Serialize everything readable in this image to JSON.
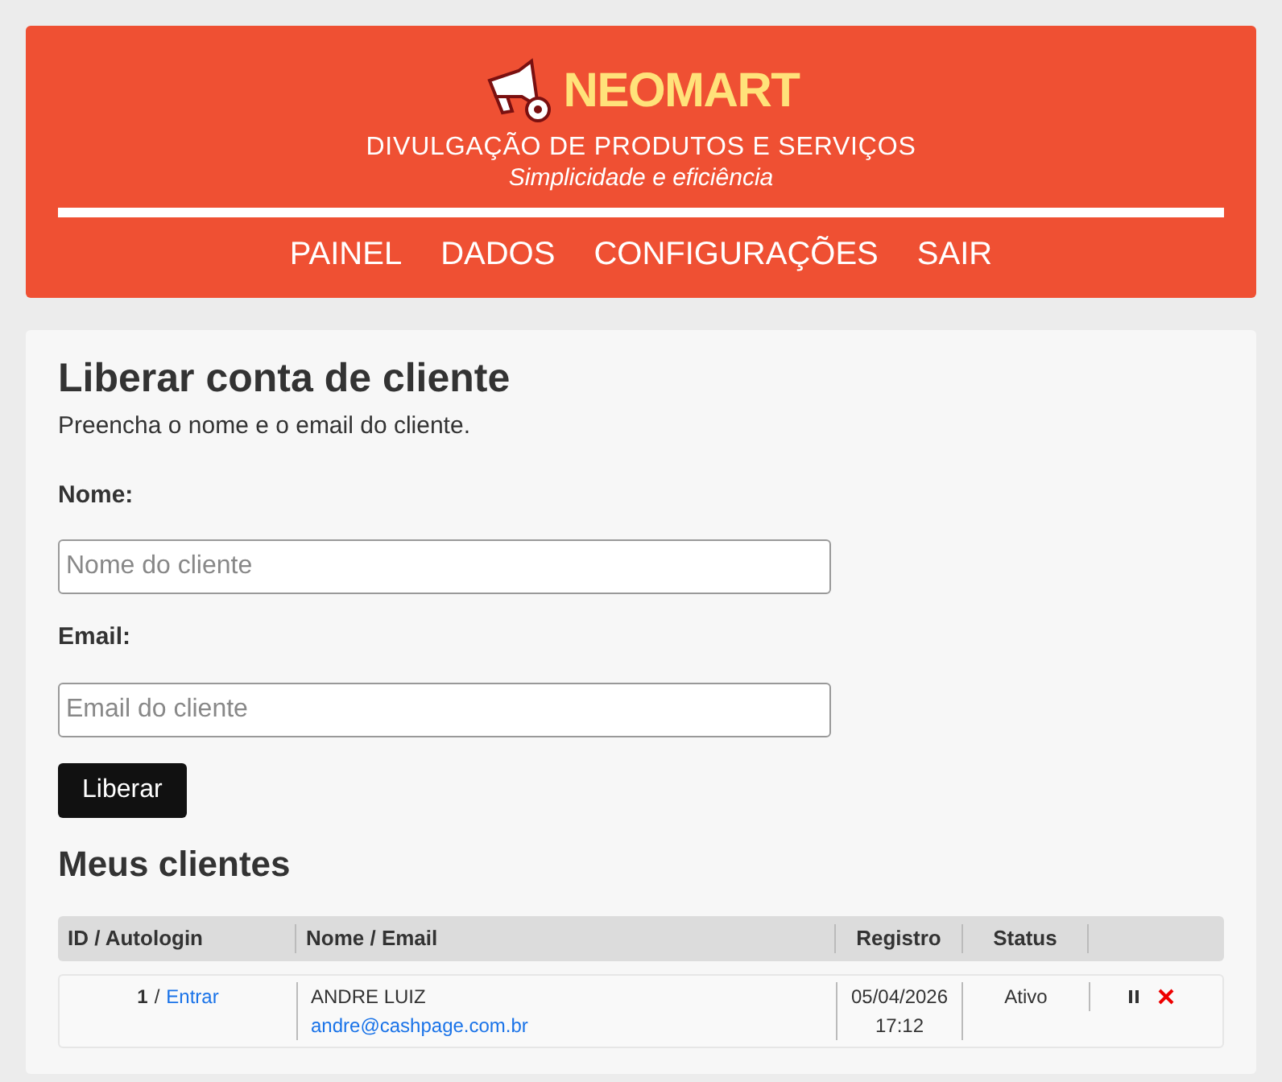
{
  "header": {
    "brand": "NEOMART",
    "tagline": "DIVULGAÇÃO DE PRODUTOS E SERVIÇOS",
    "slogan": "Simplicidade e eficiência",
    "nav": [
      {
        "label": "PAINEL"
      },
      {
        "label": "DADOS"
      },
      {
        "label": "CONFIGURAÇÕES"
      },
      {
        "label": "SAIR"
      }
    ]
  },
  "form": {
    "title": "Liberar conta de cliente",
    "subtitle": "Preencha o nome e o email do cliente.",
    "fields": [
      {
        "label": "Nome:",
        "placeholder": "Nome do cliente"
      },
      {
        "label": "Email:",
        "placeholder": "Email do cliente"
      }
    ],
    "submit": "Liberar"
  },
  "clients": {
    "title": "Meus clientes",
    "columns": [
      "ID / Autologin",
      "Nome / Email",
      "Registro",
      "Status"
    ],
    "rows": [
      {
        "id": "1",
        "separator": "/",
        "autologin": "Entrar",
        "name": "ANDRE LUIZ",
        "email": "andre@cashpage.com.br",
        "date": "05/04/2026",
        "time": "17:12",
        "status": "Ativo"
      }
    ]
  }
}
